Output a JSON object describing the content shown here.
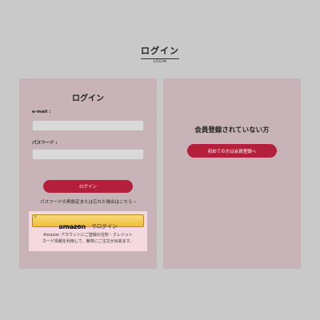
{
  "header": {
    "title": "ログイン",
    "subtitle": "LOGIN"
  },
  "login_panel": {
    "heading": "ログイン",
    "email_label": "e-mail :",
    "email_value": "",
    "password_label": "パスワード :",
    "password_value": "",
    "submit_label": "ログイン",
    "forgot_text": "パスワードの再設定または忘れた場合はこちら",
    "forgot_chevron": "›"
  },
  "amazon": {
    "corner_mark": "$",
    "logo_text": "amazon",
    "button_label": "でログイン",
    "note_line1": "Amazon アカウントにご登録の住所・クレジット",
    "note_line2": "カード情報を利用して、簡単にご注文が出来ます。"
  },
  "register_panel": {
    "heading": "会員登録されていない方",
    "button_label": "初めての方は会員登録へ"
  },
  "colors": {
    "background": "#c9c9c9",
    "panel": "#c8b4b8",
    "accent": "#b4203c",
    "amazon_button": "#f0c14b",
    "amazon_highlight": "#f5d9e0"
  }
}
